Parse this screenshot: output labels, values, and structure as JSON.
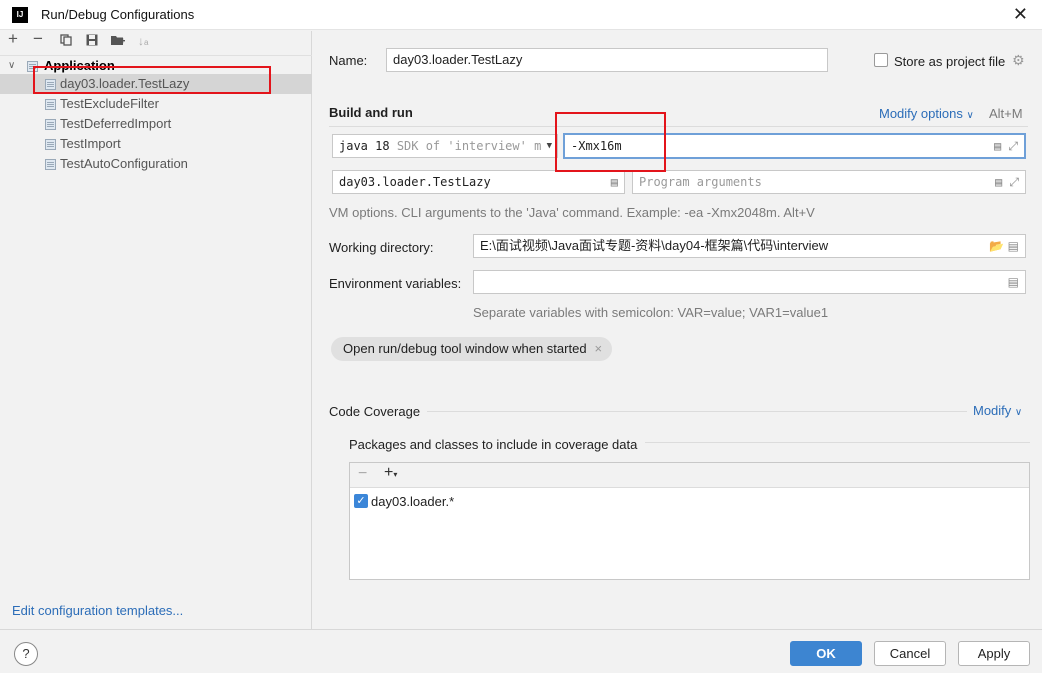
{
  "window": {
    "title": "Run/Debug Configurations",
    "app_icon": "IJ"
  },
  "toolbar": {
    "icons": [
      "add-icon",
      "remove-icon",
      "copy-icon",
      "save-icon",
      "folder-add-icon",
      "sort-icon"
    ]
  },
  "tree": {
    "group": "Application",
    "items": [
      {
        "label": "day03.loader.TestLazy",
        "selected": true
      },
      {
        "label": "TestExcludeFilter"
      },
      {
        "label": "TestDeferredImport"
      },
      {
        "label": "TestImport"
      },
      {
        "label": "TestAutoConfiguration"
      }
    ]
  },
  "edit_templates": "Edit configuration templates...",
  "form": {
    "name_label": "Name:",
    "name_value": "day03.loader.TestLazy",
    "store_label": "Store as project file",
    "build_run": "Build and run",
    "modify_options": "Modify options",
    "modify_shortcut": "Alt+M",
    "jdk": "java 18",
    "jdk_hint": "SDK of 'interview' m",
    "vm_options": "-Xmx16m",
    "main_class": "day03.loader.TestLazy",
    "program_args_placeholder": "Program arguments",
    "vm_hint": "VM options. CLI arguments to the 'Java' command. Example: -ea -Xmx2048m. Alt+V",
    "working_dir_label": "Working directory:",
    "working_dir_value": "E:\\面试视频\\Java面试专题-资料\\day04-框架篇\\代码\\interview",
    "env_label": "Environment variables:",
    "env_value": "",
    "env_hint": "Separate variables with semicolon: VAR=value; VAR1=value1",
    "chip": "Open run/debug tool window when started",
    "chip_close": "×",
    "coverage_title": "Code Coverage",
    "coverage_modify": "Modify",
    "coverage_sub": "Packages and classes to include in coverage data",
    "coverage_items": [
      {
        "label": "day03.loader.*",
        "checked": true
      }
    ]
  },
  "buttons": {
    "help": "?",
    "ok": "OK",
    "cancel": "Cancel",
    "apply": "Apply"
  },
  "colors": {
    "accent": "#3d85d1",
    "highlight_box": "#e3141b",
    "link": "#2c6db8"
  }
}
